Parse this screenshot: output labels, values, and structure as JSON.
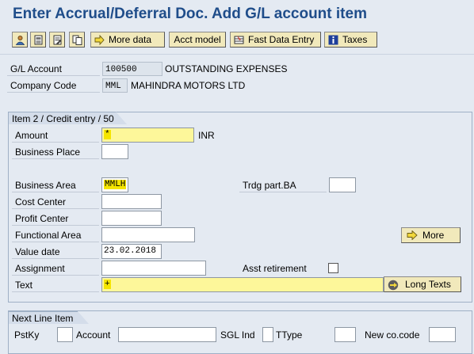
{
  "title": "Enter Accrual/Deferral Doc. Add G/L account item",
  "toolbar": {
    "buttons": [
      {
        "icon": "person-icon"
      },
      {
        "icon": "document-overview-icon"
      },
      {
        "icon": "document-edit-icon"
      },
      {
        "icon": "copy-pages-icon"
      }
    ],
    "more_data": "More data",
    "acct_model": "Acct model",
    "fast_data_entry": "Fast Data Entry",
    "taxes": "Taxes"
  },
  "header": {
    "gl_account_label": "G/L Account",
    "gl_account_value": "100500",
    "gl_account_desc": "OUTSTANDING EXPENSES",
    "company_code_label": "Company Code",
    "company_code_value": "MML",
    "company_code_desc": "MAHINDRA MOTORS LTD"
  },
  "item": {
    "section_title": "Item 2 / Credit entry / 50",
    "amount_label": "Amount",
    "amount_value": "*",
    "currency": "INR",
    "business_place_label": "Business Place",
    "business_place_value": "",
    "business_area_label": "Business Area",
    "business_area_value": "MMLH",
    "trdg_part_ba_label": "Trdg part.BA",
    "trdg_part_ba_value": "",
    "cost_center_label": "Cost Center",
    "cost_center_value": "",
    "profit_center_label": "Profit Center",
    "profit_center_value": "",
    "functional_area_label": "Functional Area",
    "functional_area_value": "",
    "more_button": "More",
    "value_date_label": "Value date",
    "value_date_value": "23.02.2018",
    "assignment_label": "Assignment",
    "assignment_value": "",
    "asst_retirement_label": "Asst retirement",
    "asst_retirement_checked": false,
    "text_label": "Text",
    "text_value": "+",
    "long_texts_button": "Long Texts"
  },
  "next_line": {
    "section_title": "Next Line Item",
    "pstky_label": "PstKy",
    "pstky_value": "",
    "account_label": "Account",
    "account_value": "",
    "sgl_ind_label": "SGL Ind",
    "sgl_ind_value": "",
    "ttype_label": "TType",
    "ttype_value": "",
    "new_co_code_label": "New co.code",
    "new_co_code_value": ""
  },
  "colors": {
    "title": "#1f4d8a",
    "background": "#e4eaf2",
    "button": "#f1e9bb",
    "required_field": "#fdf79a"
  }
}
